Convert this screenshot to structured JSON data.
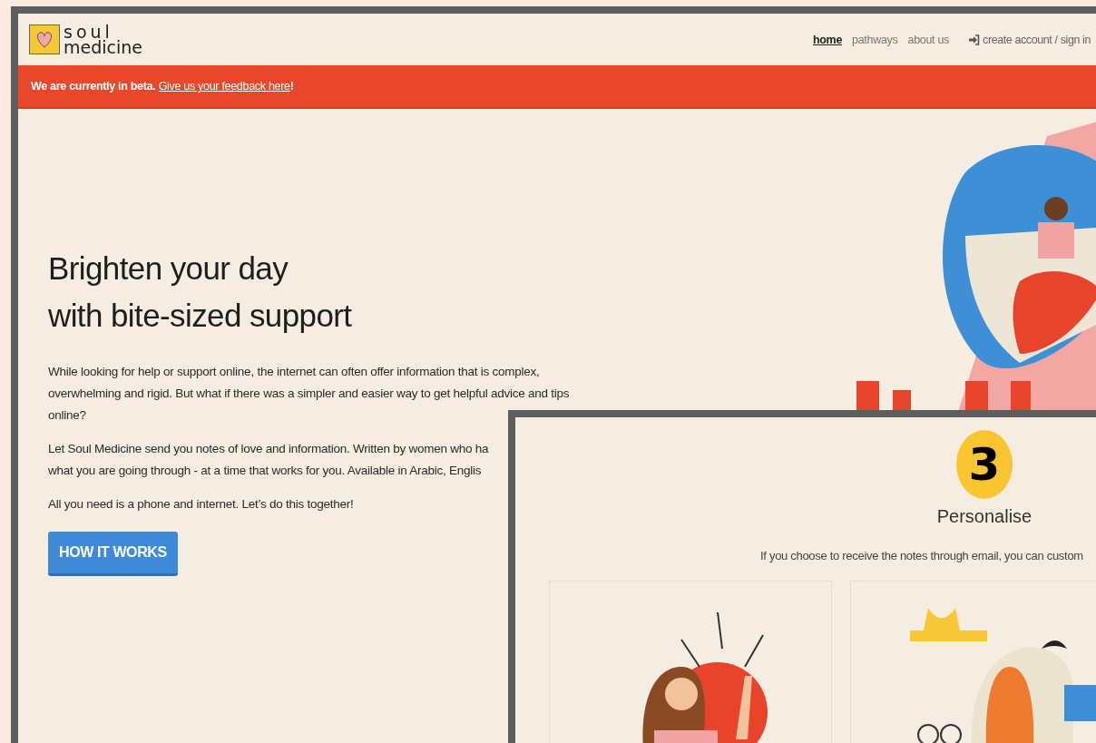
{
  "main_window": {
    "logo": {
      "line_1": "soul",
      "line_2": "medicine"
    },
    "nav": [
      {
        "label": "home",
        "selected": true
      },
      {
        "label": "pathways",
        "selected": false
      },
      {
        "label": "about us",
        "selected": false
      }
    ],
    "account_link": "create account / sign in",
    "beta_banner": {
      "text": "We are currently in beta.",
      "link": "Give us your feedback here",
      "suffix": "!"
    },
    "hero": {
      "title_lines": [
        "Brighten your day",
        "with bite-sized support"
      ],
      "paragraph_1": "While looking for help or support online, the internet can often offer information that is complex, overwhelming and rigid. But what if there was a simpler and easier way to get helpful advice and tips online?",
      "paragraph_2_lines": [
        "Let Soul Medicine send you notes of love and information. Written by women who ha",
        "what you are going through - at a time that works for you. Available in Arabic, Englis"
      ],
      "paragraph_3": "All you need is a phone and internet. Let’s do this together!",
      "button": "HOW IT WORKS"
    }
  },
  "second_window": {
    "step_number": "3",
    "step_title": "Personalise",
    "description": "If you choose to receive the notes through email, you can custom"
  }
}
